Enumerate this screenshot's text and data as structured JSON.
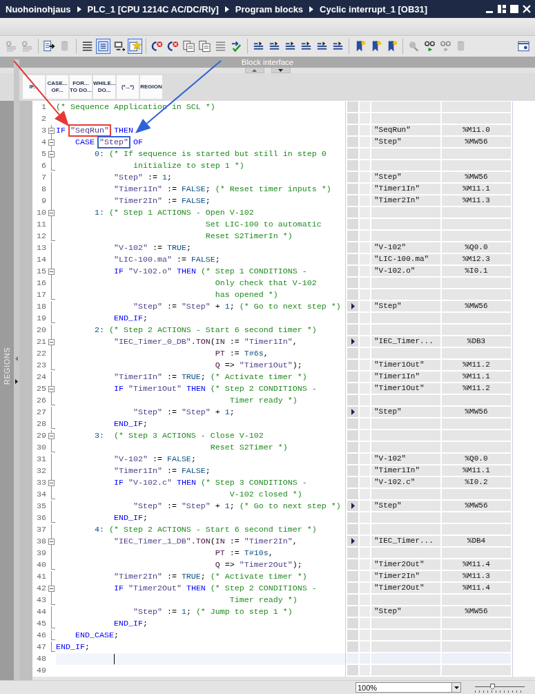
{
  "title": {
    "breadcrumb": [
      "Nuohoinohjaus",
      "PLC_1 [CPU 1214C AC/DC/Rly]",
      "Program blocks",
      "Cyclic interrupt_1 [OB31]"
    ]
  },
  "toolbar": [
    {
      "kind": "gear-lines",
      "disabled": true,
      "pressed": false
    },
    {
      "kind": "gear-lines",
      "disabled": true,
      "pressed": false
    },
    {
      "kind": "separator"
    },
    {
      "kind": "page-arrow",
      "disabled": false,
      "pressed": false
    },
    {
      "kind": "cylinder",
      "disabled": true,
      "pressed": false
    },
    {
      "kind": "separator"
    },
    {
      "kind": "lines",
      "disabled": false,
      "pressed": false
    },
    {
      "kind": "boxed-lines",
      "disabled": false,
      "pressed": true
    },
    {
      "kind": "monitor",
      "disabled": false,
      "pressed": false
    },
    {
      "kind": "star",
      "disabled": false,
      "pressed": true
    },
    {
      "kind": "separator"
    },
    {
      "kind": "arrow-x",
      "disabled": false,
      "pressed": false
    },
    {
      "kind": "arrow-x",
      "disabled": false,
      "pressed": false
    },
    {
      "kind": "pages",
      "disabled": false,
      "pressed": false
    },
    {
      "kind": "pages",
      "disabled": false,
      "pressed": false
    },
    {
      "kind": "lines",
      "disabled": true,
      "pressed": false
    },
    {
      "kind": "arrow-tick",
      "disabled": false
    },
    {
      "kind": "separator"
    },
    {
      "kind": "indent",
      "disabled": false,
      "pressed": false
    },
    {
      "kind": "indent",
      "disabled": false,
      "pressed": false
    },
    {
      "kind": "indent",
      "disabled": false,
      "pressed": false
    },
    {
      "kind": "indent",
      "disabled": false,
      "pressed": false
    },
    {
      "kind": "indent",
      "disabled": false,
      "pressed": false
    },
    {
      "kind": "indent",
      "disabled": false,
      "pressed": false
    },
    {
      "kind": "separator"
    },
    {
      "kind": "bookmark",
      "disabled": false,
      "pressed": false
    },
    {
      "kind": "bookmark",
      "disabled": false,
      "pressed": false
    },
    {
      "kind": "bookmark",
      "disabled": false,
      "pressed": false
    },
    {
      "kind": "separator"
    },
    {
      "kind": "magnifier",
      "disabled": true,
      "pressed": false
    },
    {
      "kind": "glasses",
      "disabled": false,
      "pressed": false
    },
    {
      "kind": "glasses",
      "disabled": true,
      "pressed": false
    },
    {
      "kind": "cylinder",
      "disabled": true,
      "pressed": false
    },
    {
      "kind": "panel",
      "disabled": false,
      "pressed": false
    }
  ],
  "block_interface": {
    "label": "Block interface"
  },
  "templates": [
    {
      "lines": [
        "IF..."
      ]
    },
    {
      "lines": [
        "CASE...",
        "OF..."
      ]
    },
    {
      "lines": [
        "FOR...",
        "TO DO..."
      ]
    },
    {
      "lines": [
        "WHILE...",
        "DO..."
      ]
    },
    {
      "lines": [
        "(*...*)"
      ]
    },
    {
      "lines": [
        "REGION"
      ]
    }
  ],
  "regions": {
    "label": "REGIONS"
  },
  "lines": [
    {
      "number": "1",
      "in_block": false,
      "fold_box": false,
      "block_end": false,
      "current": false,
      "expandable": false,
      "tokens": [
        {
          "kind": "comment",
          "text": "(* Sequence Application in SCL *)"
        }
      ]
    },
    {
      "number": "2",
      "in_block": false,
      "fold_box": false,
      "block_end": false,
      "current": false,
      "expandable": false
    },
    {
      "number": "3",
      "in_block": true,
      "fold_box": true,
      "block_end": false,
      "current": false,
      "expandable": false,
      "tokens": [
        {
          "kind": "keyword",
          "text": "IF "
        },
        {
          "kind": "tag",
          "text": "\"SeqRun\"",
          "color": "#e53935"
        },
        {
          "kind": "keyword",
          "text": " THEN"
        }
      ],
      "tag": "\"SeqRun\"",
      "address": "%M11.0"
    },
    {
      "number": "4",
      "in_block": true,
      "fold_box": true,
      "block_end": false,
      "current": false,
      "expandable": false,
      "tokens": [
        {
          "kind": "keyword",
          "text": "    CASE "
        },
        {
          "kind": "tag",
          "text": "\"Step\"",
          "color": "#2f62d6"
        },
        {
          "kind": "keyword",
          "text": " OF"
        }
      ],
      "tag": "\"Step\"",
      "address": "%MW56"
    },
    {
      "number": "5",
      "in_block": true,
      "fold_box": true,
      "block_end": false,
      "current": false,
      "expandable": false,
      "tokens": [
        {
          "kind": "constant",
          "text": "        0:"
        },
        {
          "kind": "comment",
          "text": " (* If sequence is started but still in step 0"
        }
      ]
    },
    {
      "number": "6",
      "in_block": true,
      "fold_box": false,
      "block_end": true,
      "current": false,
      "expandable": false,
      "tokens": [
        {
          "kind": "comment",
          "text": "                initialize to step 1 *)"
        }
      ]
    },
    {
      "number": "7",
      "in_block": true,
      "fold_box": false,
      "block_end": false,
      "current": false,
      "expandable": false,
      "tokens": [
        {
          "kind": "tag",
          "text": "            \"Step\""
        },
        {
          "kind": "plain",
          "text": " := "
        },
        {
          "kind": "constant",
          "text": "1"
        },
        {
          "kind": "plain",
          "text": ";"
        }
      ],
      "tag": "\"Step\"",
      "address": "%MW56"
    },
    {
      "number": "8",
      "in_block": true,
      "fold_box": false,
      "block_end": false,
      "current": false,
      "expandable": false,
      "tokens": [
        {
          "kind": "tag",
          "text": "            \"Timer1In\""
        },
        {
          "kind": "plain",
          "text": " := "
        },
        {
          "kind": "constant",
          "text": "FALSE"
        },
        {
          "kind": "plain",
          "text": "; "
        },
        {
          "kind": "comment",
          "text": "(* Reset timer inputs *)"
        }
      ],
      "tag": "\"Timer1In\"",
      "address": "%M11.1"
    },
    {
      "number": "9",
      "in_block": true,
      "fold_box": false,
      "block_end": false,
      "current": false,
      "expandable": false,
      "tokens": [
        {
          "kind": "tag",
          "text": "            \"Timer2In\""
        },
        {
          "kind": "plain",
          "text": " := "
        },
        {
          "kind": "constant",
          "text": "FALSE"
        },
        {
          "kind": "plain",
          "text": ";"
        }
      ],
      "tag": "\"Timer2In\"",
      "address": "%M11.3"
    },
    {
      "number": "10",
      "in_block": true,
      "fold_box": true,
      "block_end": false,
      "current": false,
      "expandable": false,
      "tokens": [
        {
          "kind": "constant",
          "text": "        1:"
        },
        {
          "kind": "comment",
          "text": " (* Step 1 ACTIONS - Open V-102"
        }
      ]
    },
    {
      "number": "11",
      "in_block": true,
      "fold_box": false,
      "block_end": false,
      "current": false,
      "expandable": false,
      "tokens": [
        {
          "kind": "comment",
          "text": "                               Set LIC-100 to automatic"
        }
      ]
    },
    {
      "number": "12",
      "in_block": true,
      "fold_box": false,
      "block_end": true,
      "current": false,
      "expandable": false,
      "tokens": [
        {
          "kind": "comment",
          "text": "                               Reset S2TimerIn *)"
        }
      ]
    },
    {
      "number": "13",
      "in_block": true,
      "fold_box": false,
      "block_end": false,
      "current": false,
      "expandable": false,
      "tokens": [
        {
          "kind": "tag",
          "text": "            \"V-102\""
        },
        {
          "kind": "plain",
          "text": " := "
        },
        {
          "kind": "constant",
          "text": "TRUE"
        },
        {
          "kind": "plain",
          "text": ";"
        }
      ],
      "tag": "\"V-102\"",
      "address": "%Q0.0"
    },
    {
      "number": "14",
      "in_block": true,
      "fold_box": false,
      "block_end": false,
      "current": false,
      "expandable": false,
      "tokens": [
        {
          "kind": "tag",
          "text": "            \"LIC-100.ma\""
        },
        {
          "kind": "plain",
          "text": " := "
        },
        {
          "kind": "constant",
          "text": "FALSE"
        },
        {
          "kind": "plain",
          "text": ";"
        }
      ],
      "tag": "\"LIC-100.ma\"",
      "address": "%M12.3"
    },
    {
      "number": "15",
      "in_block": true,
      "fold_box": true,
      "block_end": false,
      "current": false,
      "expandable": false,
      "tokens": [
        {
          "kind": "keyword",
          "text": "            IF "
        },
        {
          "kind": "tag",
          "text": "\"V-102.o\""
        },
        {
          "kind": "keyword",
          "text": " THEN"
        },
        {
          "kind": "comment",
          "text": " (* Step 1 CONDITIONS -"
        }
      ],
      "tag": "\"V-102.o\"",
      "address": "%I0.1"
    },
    {
      "number": "16",
      "in_block": true,
      "fold_box": false,
      "block_end": false,
      "current": false,
      "expandable": false,
      "tokens": [
        {
          "kind": "comment",
          "text": "                                 Only check that V-102"
        }
      ]
    },
    {
      "number": "17",
      "in_block": true,
      "fold_box": false,
      "block_end": true,
      "current": false,
      "expandable": false,
      "tokens": [
        {
          "kind": "comment",
          "text": "                                 has opened *)"
        }
      ]
    },
    {
      "number": "18",
      "in_block": true,
      "fold_box": false,
      "block_end": false,
      "current": false,
      "expandable": true,
      "tokens": [
        {
          "kind": "tag",
          "text": "                \"Step\""
        },
        {
          "kind": "plain",
          "text": " := "
        },
        {
          "kind": "tag",
          "text": "\"Step\""
        },
        {
          "kind": "plain",
          "text": " + "
        },
        {
          "kind": "constant",
          "text": "1"
        },
        {
          "kind": "plain",
          "text": "; "
        },
        {
          "kind": "comment",
          "text": "(* Go to next step *)"
        }
      ],
      "tag": "\"Step\"",
      "address": "%MW56"
    },
    {
      "number": "19",
      "in_block": true,
      "fold_box": false,
      "block_end": true,
      "current": false,
      "expandable": false,
      "tokens": [
        {
          "kind": "keyword",
          "text": "            END_IF"
        },
        {
          "kind": "plain",
          "text": ";"
        }
      ]
    },
    {
      "number": "20",
      "in_block": true,
      "fold_box": false,
      "block_end": false,
      "current": false,
      "expandable": false,
      "tokens": [
        {
          "kind": "constant",
          "text": "        2:"
        },
        {
          "kind": "comment",
          "text": " (* Step 2 ACTIONS - Start 6 second timer *)"
        }
      ]
    },
    {
      "number": "21",
      "in_block": true,
      "fold_box": true,
      "block_end": false,
      "current": false,
      "expandable": true,
      "tokens": [
        {
          "kind": "tag",
          "text": "            \"IEC_Timer_0_DB\""
        },
        {
          "kind": "plain",
          "text": "."
        },
        {
          "kind": "instruction",
          "text": "TON"
        },
        {
          "kind": "plain",
          "text": "("
        },
        {
          "kind": "instruction",
          "text": "IN"
        },
        {
          "kind": "plain",
          "text": " := "
        },
        {
          "kind": "tag",
          "text": "\"Timer1In\""
        },
        {
          "kind": "plain",
          "text": ","
        }
      ],
      "tag": "\"IEC_Timer...",
      "address": "%DB3"
    },
    {
      "number": "22",
      "in_block": true,
      "fold_box": false,
      "block_end": false,
      "current": false,
      "expandable": false,
      "tokens": [
        {
          "kind": "instruction",
          "text": "                                 PT"
        },
        {
          "kind": "plain",
          "text": " := "
        },
        {
          "kind": "constant",
          "text": "T#6s"
        },
        {
          "kind": "plain",
          "text": ","
        }
      ]
    },
    {
      "number": "23",
      "in_block": true,
      "fold_box": false,
      "block_end": true,
      "current": false,
      "expandable": false,
      "tokens": [
        {
          "kind": "instruction",
          "text": "                                 Q"
        },
        {
          "kind": "plain",
          "text": " => "
        },
        {
          "kind": "tag",
          "text": "\"Timer1Out\""
        },
        {
          "kind": "plain",
          "text": ");"
        }
      ],
      "tag": "\"Timer1Out\"",
      "address": "%M11.2"
    },
    {
      "number": "24",
      "in_block": true,
      "fold_box": false,
      "block_end": false,
      "current": false,
      "expandable": false,
      "tokens": [
        {
          "kind": "tag",
          "text": "            \"Timer1In\""
        },
        {
          "kind": "plain",
          "text": " := "
        },
        {
          "kind": "constant",
          "text": "TRUE"
        },
        {
          "kind": "plain",
          "text": "; "
        },
        {
          "kind": "comment",
          "text": "(* Activate timer *)"
        }
      ],
      "tag": "\"Timer1In\"",
      "address": "%M11.1"
    },
    {
      "number": "25",
      "in_block": true,
      "fold_box": true,
      "block_end": false,
      "current": false,
      "expandable": false,
      "tokens": [
        {
          "kind": "keyword",
          "text": "            IF "
        },
        {
          "kind": "tag",
          "text": "\"Timer1Out\""
        },
        {
          "kind": "keyword",
          "text": " THEN"
        },
        {
          "kind": "comment",
          "text": " (* Step 2 CONDITIONS -"
        }
      ],
      "tag": "\"Timer1Out\"",
      "address": "%M11.2"
    },
    {
      "number": "26",
      "in_block": true,
      "fold_box": false,
      "block_end": true,
      "current": false,
      "expandable": false,
      "tokens": [
        {
          "kind": "comment",
          "text": "                                    Timer ready *)"
        }
      ]
    },
    {
      "number": "27",
      "in_block": true,
      "fold_box": false,
      "block_end": false,
      "current": false,
      "expandable": true,
      "tokens": [
        {
          "kind": "tag",
          "text": "                \"Step\""
        },
        {
          "kind": "plain",
          "text": " := "
        },
        {
          "kind": "tag",
          "text": "\"Step\""
        },
        {
          "kind": "plain",
          "text": " + "
        },
        {
          "kind": "constant",
          "text": "1"
        },
        {
          "kind": "plain",
          "text": ";"
        }
      ],
      "tag": "\"Step\"",
      "address": "%MW56"
    },
    {
      "number": "28",
      "in_block": true,
      "fold_box": false,
      "block_end": true,
      "current": false,
      "expandable": false,
      "tokens": [
        {
          "kind": "keyword",
          "text": "            END_IF"
        },
        {
          "kind": "plain",
          "text": ";"
        }
      ]
    },
    {
      "number": "29",
      "in_block": true,
      "fold_box": true,
      "block_end": false,
      "current": false,
      "expandable": false,
      "tokens": [
        {
          "kind": "constant",
          "text": "        3:"
        },
        {
          "kind": "comment",
          "text": "  (* Step 3 ACTIONS - Close V-102"
        }
      ]
    },
    {
      "number": "30",
      "in_block": true,
      "fold_box": false,
      "block_end": true,
      "current": false,
      "expandable": false,
      "tokens": [
        {
          "kind": "comment",
          "text": "                                Reset S2Timer *)"
        }
      ]
    },
    {
      "number": "31",
      "in_block": true,
      "fold_box": false,
      "block_end": false,
      "current": false,
      "expandable": false,
      "tokens": [
        {
          "kind": "tag",
          "text": "            \"V-102\""
        },
        {
          "kind": "plain",
          "text": " := "
        },
        {
          "kind": "constant",
          "text": "FALSE"
        },
        {
          "kind": "plain",
          "text": ";"
        }
      ],
      "tag": "\"V-102\"",
      "address": "%Q0.0"
    },
    {
      "number": "32",
      "in_block": true,
      "fold_box": false,
      "block_end": false,
      "current": false,
      "expandable": false,
      "tokens": [
        {
          "kind": "tag",
          "text": "            \"Timer1In\""
        },
        {
          "kind": "plain",
          "text": " := "
        },
        {
          "kind": "constant",
          "text": "FALSE"
        },
        {
          "kind": "plain",
          "text": ";"
        }
      ],
      "tag": "\"Timer1In\"",
      "address": "%M11.1"
    },
    {
      "number": "33",
      "in_block": true,
      "fold_box": true,
      "block_end": false,
      "current": false,
      "expandable": false,
      "tokens": [
        {
          "kind": "keyword",
          "text": "            IF "
        },
        {
          "kind": "tag",
          "text": "\"V-102.c\""
        },
        {
          "kind": "keyword",
          "text": " THEN"
        },
        {
          "kind": "comment",
          "text": " (* Step 3 CONDITIONS -"
        }
      ],
      "tag": "\"V-102.c\"",
      "address": "%I0.2"
    },
    {
      "number": "34",
      "in_block": true,
      "fold_box": false,
      "block_end": true,
      "current": false,
      "expandable": false,
      "tokens": [
        {
          "kind": "comment",
          "text": "                                    V-102 closed *)"
        }
      ]
    },
    {
      "number": "35",
      "in_block": true,
      "fold_box": false,
      "block_end": false,
      "current": false,
      "expandable": true,
      "tokens": [
        {
          "kind": "tag",
          "text": "                \"Step\""
        },
        {
          "kind": "plain",
          "text": " := "
        },
        {
          "kind": "tag",
          "text": "\"Step\""
        },
        {
          "kind": "plain",
          "text": " + "
        },
        {
          "kind": "constant",
          "text": "1"
        },
        {
          "kind": "plain",
          "text": "; "
        },
        {
          "kind": "comment",
          "text": "(* Go to next step *)"
        }
      ],
      "tag": "\"Step\"",
      "address": "%MW56"
    },
    {
      "number": "36",
      "in_block": true,
      "fold_box": false,
      "block_end": true,
      "current": false,
      "expandable": false,
      "tokens": [
        {
          "kind": "keyword",
          "text": "            END_IF"
        },
        {
          "kind": "plain",
          "text": ";"
        }
      ]
    },
    {
      "number": "37",
      "in_block": true,
      "fold_box": false,
      "block_end": false,
      "current": false,
      "expandable": false,
      "tokens": [
        {
          "kind": "constant",
          "text": "        4:"
        },
        {
          "kind": "comment",
          "text": " (* Step 2 ACTIONS - Start 6 second timer *)"
        }
      ]
    },
    {
      "number": "38",
      "in_block": true,
      "fold_box": true,
      "block_end": false,
      "current": false,
      "expandable": true,
      "tokens": [
        {
          "kind": "tag",
          "text": "            \"IEC_Timer_1_DB\""
        },
        {
          "kind": "plain",
          "text": "."
        },
        {
          "kind": "instruction",
          "text": "TON"
        },
        {
          "kind": "plain",
          "text": "("
        },
        {
          "kind": "instruction",
          "text": "IN"
        },
        {
          "kind": "plain",
          "text": " := "
        },
        {
          "kind": "tag",
          "text": "\"Timer2In\""
        },
        {
          "kind": "plain",
          "text": ","
        }
      ],
      "tag": "\"IEC_Timer...",
      "address": "%DB4"
    },
    {
      "number": "39",
      "in_block": true,
      "fold_box": false,
      "block_end": false,
      "current": false,
      "expandable": false,
      "tokens": [
        {
          "kind": "instruction",
          "text": "                                 PT"
        },
        {
          "kind": "plain",
          "text": " := "
        },
        {
          "kind": "constant",
          "text": "T#10s"
        },
        {
          "kind": "plain",
          "text": ","
        }
      ]
    },
    {
      "number": "40",
      "in_block": true,
      "fold_box": false,
      "block_end": true,
      "current": false,
      "expandable": false,
      "tokens": [
        {
          "kind": "instruction",
          "text": "                                 Q"
        },
        {
          "kind": "plain",
          "text": " => "
        },
        {
          "kind": "tag",
          "text": "\"Timer2Out\""
        },
        {
          "kind": "plain",
          "text": ");"
        }
      ],
      "tag": "\"Timer2Out\"",
      "address": "%M11.4"
    },
    {
      "number": "41",
      "in_block": true,
      "fold_box": false,
      "block_end": false,
      "current": false,
      "expandable": false,
      "tokens": [
        {
          "kind": "tag",
          "text": "            \"Timer2In\""
        },
        {
          "kind": "plain",
          "text": " := "
        },
        {
          "kind": "constant",
          "text": "TRUE"
        },
        {
          "kind": "plain",
          "text": "; "
        },
        {
          "kind": "comment",
          "text": "(* Activate timer *)"
        }
      ],
      "tag": "\"Timer2In\"",
      "address": "%M11.3"
    },
    {
      "number": "42",
      "in_block": true,
      "fold_box": true,
      "block_end": false,
      "current": false,
      "expandable": false,
      "tokens": [
        {
          "kind": "keyword",
          "text": "            IF "
        },
        {
          "kind": "tag",
          "text": "\"Timer2Out\""
        },
        {
          "kind": "keyword",
          "text": " THEN"
        },
        {
          "kind": "comment",
          "text": " (* Step 2 CONDITIONS -"
        }
      ],
      "tag": "\"Timer2Out\"",
      "address": "%M11.4"
    },
    {
      "number": "43",
      "in_block": true,
      "fold_box": false,
      "block_end": true,
      "current": false,
      "expandable": false,
      "tokens": [
        {
          "kind": "comment",
          "text": "                                    Timer ready *)"
        }
      ]
    },
    {
      "number": "44",
      "in_block": true,
      "fold_box": false,
      "block_end": false,
      "current": false,
      "expandable": false,
      "tokens": [
        {
          "kind": "tag",
          "text": "                \"Step\""
        },
        {
          "kind": "plain",
          "text": " := "
        },
        {
          "kind": "constant",
          "text": "1"
        },
        {
          "kind": "plain",
          "text": "; "
        },
        {
          "kind": "comment",
          "text": "(* Jump to step 1 *)"
        }
      ],
      "tag": "\"Step\"",
      "address": "%MW56"
    },
    {
      "number": "45",
      "in_block": true,
      "fold_box": false,
      "block_end": true,
      "current": false,
      "expandable": false,
      "tokens": [
        {
          "kind": "keyword",
          "text": "            END_IF"
        },
        {
          "kind": "plain",
          "text": ";"
        }
      ]
    },
    {
      "number": "46",
      "in_block": true,
      "fold_box": false,
      "block_end": true,
      "current": false,
      "expandable": false,
      "tokens": [
        {
          "kind": "keyword",
          "text": "    END_CASE"
        },
        {
          "kind": "plain",
          "text": ";"
        }
      ]
    },
    {
      "number": "47",
      "in_block": true,
      "fold_box": false,
      "block_end": true,
      "current": false,
      "expandable": false,
      "tokens": [
        {
          "kind": "keyword",
          "text": "END_IF"
        },
        {
          "kind": "plain",
          "text": ";"
        }
      ]
    },
    {
      "number": "48",
      "in_block": false,
      "fold_box": false,
      "block_end": false,
      "current": true,
      "expandable": false
    },
    {
      "number": "49",
      "in_block": false,
      "fold_box": false,
      "block_end": false,
      "current": false,
      "expandable": false
    }
  ],
  "status": {
    "zoom": {
      "value": "100%",
      "level": 0.35
    }
  }
}
